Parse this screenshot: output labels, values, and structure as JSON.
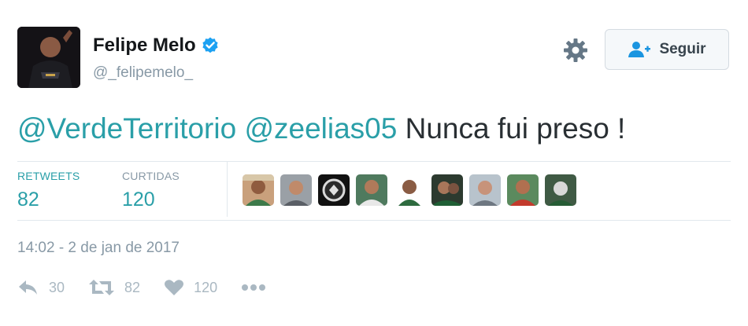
{
  "user": {
    "name": "Felipe Melo",
    "handle": "@_felipemelo_",
    "verified_icon": "verified-badge-icon"
  },
  "header": {
    "follow_label": "Seguir",
    "settings_icon": "gear-icon",
    "follow_icon": "add-user-icon"
  },
  "tweet": {
    "mention_1": "@VerdeTerritorio",
    "mention_2": "@zeelias05",
    "text": "Nunca fui preso !"
  },
  "stats": {
    "retweets_label": "RETWEETS",
    "retweets_value": "82",
    "likes_label": "CURTIDAS",
    "likes_value": "120"
  },
  "timestamp": "14:02 - 2 de jan de 2017",
  "actions": {
    "reply_count": "30",
    "retweet_count": "82",
    "like_count": "120"
  },
  "colors": {
    "accent": "#2a9fa8",
    "verified": "#1da1f2",
    "muted": "#8899a6"
  }
}
